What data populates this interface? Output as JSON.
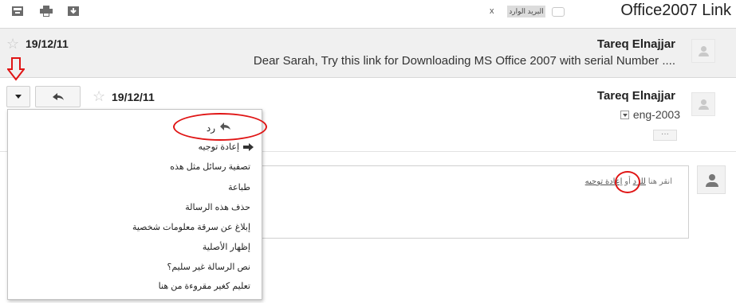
{
  "toolbar": {
    "icons": [
      "archive-icon",
      "print-icon",
      "download-icon"
    ]
  },
  "thread": {
    "subject": "Office2007 Link",
    "label": "البريد الوارد",
    "label_remove": "x"
  },
  "messages": [
    {
      "sender": "Tareq Elnajjar",
      "date": "19/12/11",
      "snippet": "Dear Sarah, Try this link for Downloading MS Office 2007 with serial Number ...."
    },
    {
      "sender": "Tareq Elnajjar",
      "date": "19/12/11",
      "to": "eng-2003",
      "expand_dots": "···"
    }
  ],
  "menu": {
    "items": [
      {
        "label": "رد",
        "icon": "reply-arrow-icon"
      },
      {
        "label": "إعادة توجيه",
        "icon": "forward-arrow-icon"
      },
      {
        "label": "تصفية رسائل مثل هذه"
      },
      {
        "label": "طباعة"
      },
      {
        "label": "حذف هذه الرسالة"
      },
      {
        "label": "إبلاغ عن سرقة معلومات شخصية"
      },
      {
        "label": "إظهار الأصلية"
      },
      {
        "label": "نص الرسالة غير سليم؟"
      },
      {
        "label": "تعليم كغير مقروءة من هنا"
      }
    ]
  },
  "reply_box": {
    "prefix": "انقر هنا",
    "reply_link": "للرد",
    "or": "أو",
    "forward_link": "إعادة توجيه"
  },
  "annotation": {
    "color": "#e01515"
  }
}
